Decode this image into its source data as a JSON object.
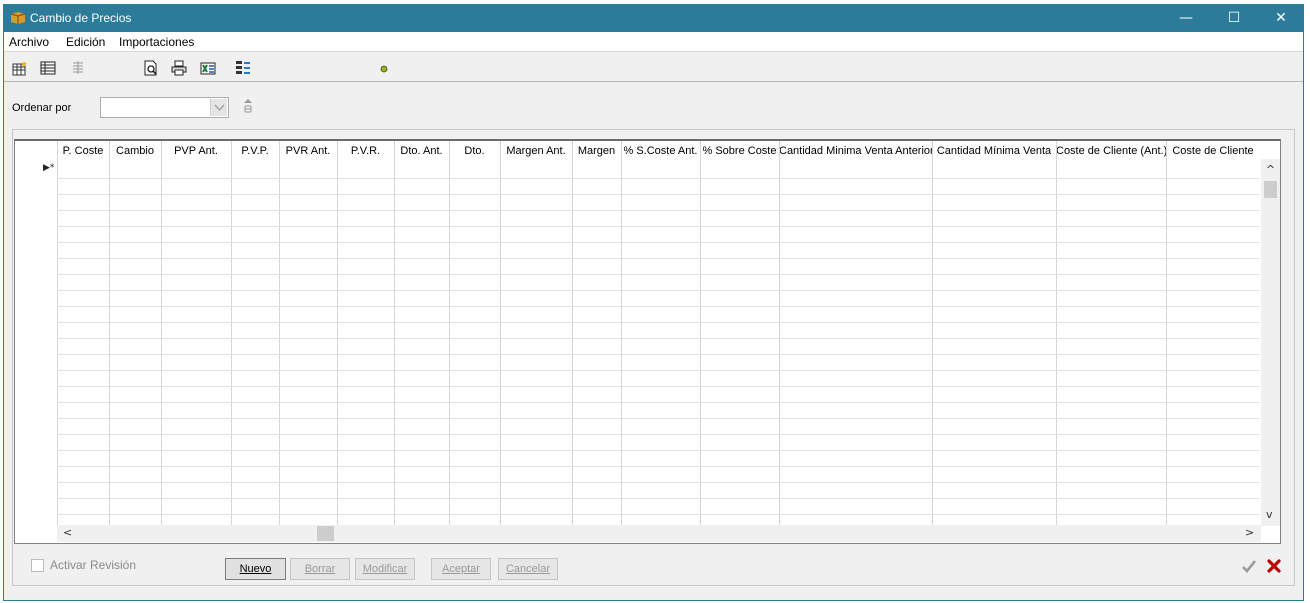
{
  "window": {
    "title": "Cambio de Precios",
    "minimize": "—",
    "maximize": "☐",
    "close": "✕"
  },
  "menu": [
    "Archivo",
    "Edición",
    "Importaciones"
  ],
  "sort": {
    "label": "Ordenar por",
    "value": ""
  },
  "grid": {
    "columns": [
      "P. Coste",
      "Cambio",
      "PVP Ant.",
      "P.V.P.",
      "PVR Ant.",
      "P.V.R.",
      "Dto. Ant.",
      "Dto.",
      "Margen Ant.",
      "Margen",
      "% S.Coste Ant.",
      "% Sobre Coste",
      "Cantidad Minima Venta Anterior",
      "Cantidad Mínima Venta",
      "Coste de Cliente (Ant.)",
      "Coste de Cliente"
    ],
    "new_row_marker": "▶*",
    "scroll_up": "^",
    "scroll_down": "v",
    "scroll_left": "<",
    "scroll_right": ">"
  },
  "footer": {
    "activar_revision": "Activar Revisión",
    "buttons": [
      "Nuevo",
      "Borrar",
      "Modificar",
      "Aceptar",
      "Cancelar"
    ]
  },
  "colors": {
    "titlebar": "#2b7b99",
    "accept": "#9a9a9a",
    "cancel": "#c00000"
  }
}
